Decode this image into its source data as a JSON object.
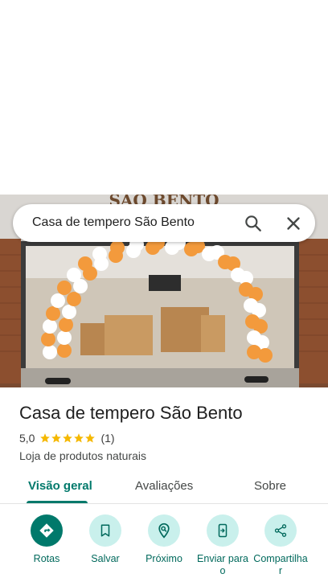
{
  "search": {
    "query": "Casa de tempero São Bento",
    "search_icon": "search-icon",
    "close_icon": "close-icon"
  },
  "photo": {
    "storefront_sign": "SÃO BENTO"
  },
  "place": {
    "title": "Casa de tempero São Bento",
    "rating": "5,0",
    "stars": 5,
    "review_count": "(1)",
    "category": "Loja de produtos naturais"
  },
  "tabs": [
    {
      "label": "Visão geral",
      "active": true
    },
    {
      "label": "Avaliações",
      "active": false
    },
    {
      "label": "Sobre",
      "active": false
    }
  ],
  "actions": [
    {
      "label": "Rotas",
      "icon": "directions-icon"
    },
    {
      "label": "Salvar",
      "icon": "bookmark-icon"
    },
    {
      "label": "Próximo",
      "icon": "nearby-icon"
    },
    {
      "label_line1": "Enviar para",
      "label_line2": "o",
      "icon": "send-to-phone-icon"
    },
    {
      "label_line1": "Compartilha",
      "label_line2": "r",
      "icon": "share-icon"
    }
  ],
  "colors": {
    "accent": "#00796b",
    "action_bg": "#c9f0ec",
    "star": "#f5b800"
  }
}
